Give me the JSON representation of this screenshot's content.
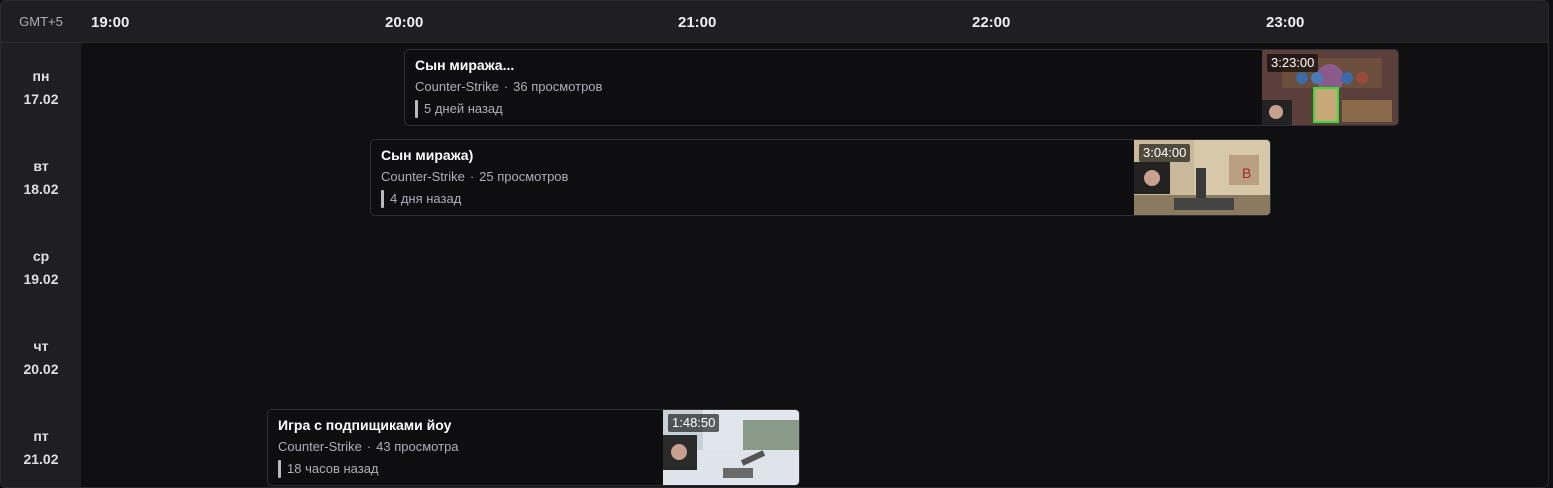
{
  "header": {
    "timezone": "GMT+5",
    "hours": [
      "19:00",
      "20:00",
      "21:00",
      "22:00",
      "23:00"
    ]
  },
  "days": [
    {
      "weekday": "пн",
      "date": "17.02"
    },
    {
      "weekday": "вт",
      "date": "18.02"
    },
    {
      "weekday": "ср",
      "date": "19.02"
    },
    {
      "weekday": "чт",
      "date": "20.02"
    },
    {
      "weekday": "пт",
      "date": "21.02"
    }
  ],
  "videos": [
    {
      "title": "Сын миража...",
      "game": "Counter-Strike",
      "views": "36 просмотров",
      "ago": "5 дней назад",
      "duration": "3:23:00",
      "thumb_icon": "card-game-thumbnail"
    },
    {
      "title": "Сын миража)",
      "game": "Counter-Strike",
      "views": "25 просмотров",
      "ago": "4 дня назад",
      "duration": "3:04:00",
      "thumb_icon": "fps-game-thumbnail"
    },
    {
      "title": "Игра с подпищиками йоу",
      "game": "Counter-Strike",
      "views": "43 просмотра",
      "ago": "18 часов назад",
      "duration": "1:48:50",
      "thumb_icon": "fps-snow-thumbnail"
    }
  ],
  "colors": {
    "background": "#0f0f11",
    "panel": "#1f1f23",
    "text": "#efeff1",
    "muted": "#adadb8"
  }
}
